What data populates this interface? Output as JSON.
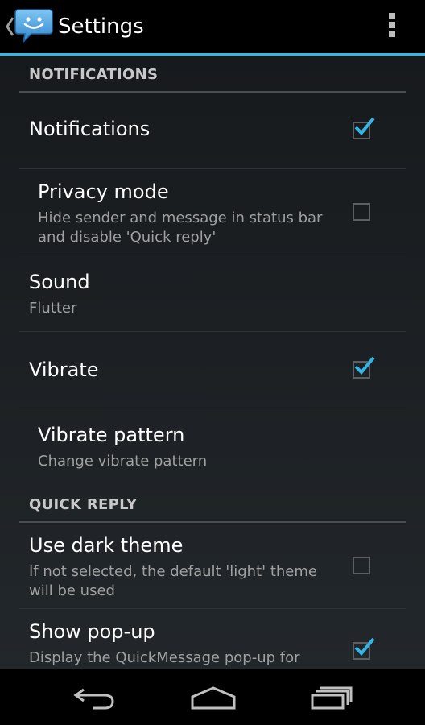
{
  "action_bar": {
    "title": "Settings",
    "icons": {
      "back": "chevron-left-icon",
      "app": "speech-bubble-smiley-icon",
      "overflow": "overflow-menu-icon"
    },
    "accent_color": "#33b5e5"
  },
  "sections": [
    {
      "header": "NOTIFICATIONS",
      "items": [
        {
          "title": "Notifications",
          "summary": "",
          "checkbox": true,
          "checked": true
        },
        {
          "title": "Privacy mode",
          "summary": "Hide sender and message in status bar and disable 'Quick reply'",
          "checkbox": true,
          "checked": false
        },
        {
          "title": "Sound",
          "summary": "Flutter",
          "checkbox": false
        },
        {
          "title": "Vibrate",
          "summary": "",
          "checkbox": true,
          "checked": true
        },
        {
          "title": "Vibrate pattern",
          "summary": "Change vibrate pattern",
          "checkbox": false
        }
      ]
    },
    {
      "header": "QUICK REPLY",
      "items": [
        {
          "title": "Use dark theme",
          "summary": "If not selected, the default 'light' theme will be used",
          "checkbox": true,
          "checked": false
        },
        {
          "title": "Show pop-up",
          "summary": "Display the QuickMessage pop-up for",
          "checkbox": true,
          "checked": true
        }
      ]
    }
  ],
  "nav_bar": {
    "icons": [
      "back-arrow-icon",
      "home-icon",
      "recent-apps-icon"
    ]
  }
}
